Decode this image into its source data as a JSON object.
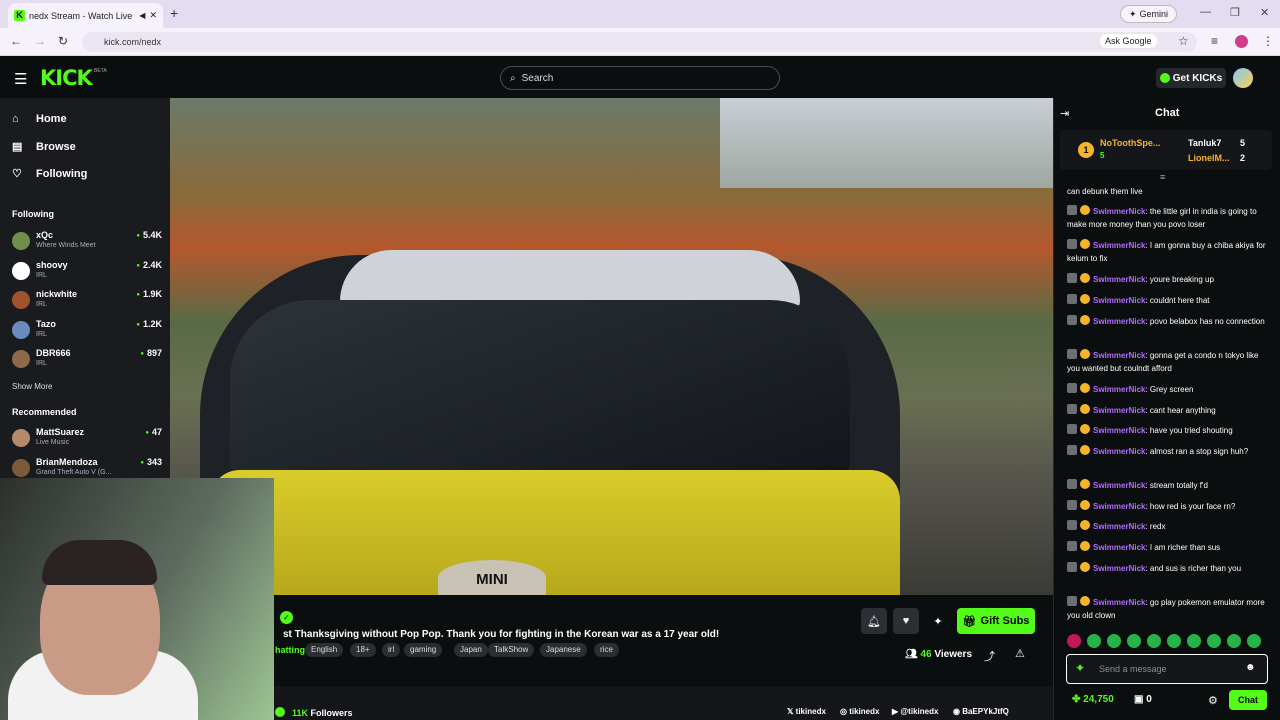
{
  "browser": {
    "tab_title": "nedx Stream - Watch Live o",
    "new_tab": "+",
    "gemini": "Gemini",
    "url": "kick.com/nedx",
    "ask_google": "Ask Google"
  },
  "header": {
    "logo": "KICK",
    "beta": "BETA",
    "search_placeholder": "Search",
    "get_kicks": "Get KICKs"
  },
  "sidebar": {
    "nav": [
      {
        "label": "Home",
        "icon": "home-icon"
      },
      {
        "label": "Browse",
        "icon": "browse-icon"
      },
      {
        "label": "Following",
        "icon": "heart-icon"
      }
    ],
    "following_title": "Following",
    "following": [
      {
        "name": "xQc",
        "category": "Where Winds Meet",
        "viewers": "5.4K",
        "color": "#6f8f4a"
      },
      {
        "name": "shoovy",
        "category": "IRL",
        "viewers": "2.4K",
        "color": "#ffffff"
      },
      {
        "name": "nickwhite",
        "category": "IRL",
        "viewers": "1.9K",
        "color": "#a0522d"
      },
      {
        "name": "Tazo",
        "category": "IRL",
        "viewers": "1.2K",
        "color": "#6a8bbd"
      },
      {
        "name": "DBR666",
        "category": "IRL",
        "viewers": "897",
        "color": "#8c6a4a"
      }
    ],
    "show_more": "Show More",
    "recommended_title": "Recommended",
    "recommended": [
      {
        "name": "MattSuarez",
        "category": "Live Music",
        "viewers": "47",
        "color": "#b48a6a"
      },
      {
        "name": "BrianMendoza",
        "category": "Grand Theft Auto V (G...",
        "viewers": "343",
        "color": "#7a5a3a"
      }
    ]
  },
  "stream": {
    "car_badge": "MINI",
    "title": "st Thanksgiving without Pop Pop. Thank you for fighting in the Korean war as a 17 year old!",
    "language_prefix": "hatting",
    "tags": [
      "English",
      "18+",
      "irl",
      "gaming",
      "Japan",
      "TalkShow",
      "Japanese",
      "rice"
    ],
    "gift_subs": "Gift Subs",
    "viewers_count": "46",
    "viewers_label": "Viewers",
    "followers_count": "11K",
    "followers_label": "Followers",
    "socials": [
      "tikinedx",
      "tikinedx",
      "@tikinedx",
      "BaEPYkJtfQ"
    ]
  },
  "chat": {
    "title": "Chat",
    "leaderboard": [
      {
        "rank": "1",
        "name": "NoToothSpe...",
        "count": "5"
      },
      {
        "name": "Tanluk7",
        "count": "5"
      },
      {
        "name": "LionelM...",
        "count": "2"
      }
    ],
    "first_line": "can debunk them live",
    "messages": [
      {
        "user": "SwimmerNick",
        "text": ": the little girl in india is going to make more money than you povo loser"
      },
      {
        "user": "SwimmerNick",
        "text": ": I am gonna buy a chiba akiya for kelum to fix"
      },
      {
        "user": "SwimmerNick",
        "text": ": youre breaking up"
      },
      {
        "user": "SwimmerNick",
        "text": ": couldnt here that"
      },
      {
        "user": "SwimmerNick",
        "text": ": povo belabox has no connection"
      },
      {
        "user": "SwimmerNick",
        "text": ": gonna get a condo n tokyo like you wanted but coulndt afford"
      },
      {
        "user": "SwimmerNick",
        "text": ": Grey screen"
      },
      {
        "user": "SwimmerNick",
        "text": ": cant hear anything"
      },
      {
        "user": "SwimmerNick",
        "text": ": have you tried shouting"
      },
      {
        "user": "SwimmerNick",
        "text": ": almost ran a stop sign huh?"
      },
      {
        "user": "SwimmerNick",
        "text": ": stream totally f'd"
      },
      {
        "user": "SwimmerNick",
        "text": ": how red is your face rn?"
      },
      {
        "user": "SwimmerNick",
        "text": ": redx"
      },
      {
        "user": "SwimmerNick",
        "text": ": I am richer than sus"
      },
      {
        "user": "SwimmerNick",
        "text": ": and sus is richer than you"
      },
      {
        "user": "SwimmerNick",
        "text": ": go play pokemon emulator more you old clown"
      }
    ],
    "send_placeholder": "Send a message",
    "kicks_balance": "24,750",
    "gift_count": "0",
    "chat_button": "Chat"
  },
  "colors": {
    "accent": "#53fc18",
    "username": "#b16cff",
    "background": "#0b0e0f"
  }
}
